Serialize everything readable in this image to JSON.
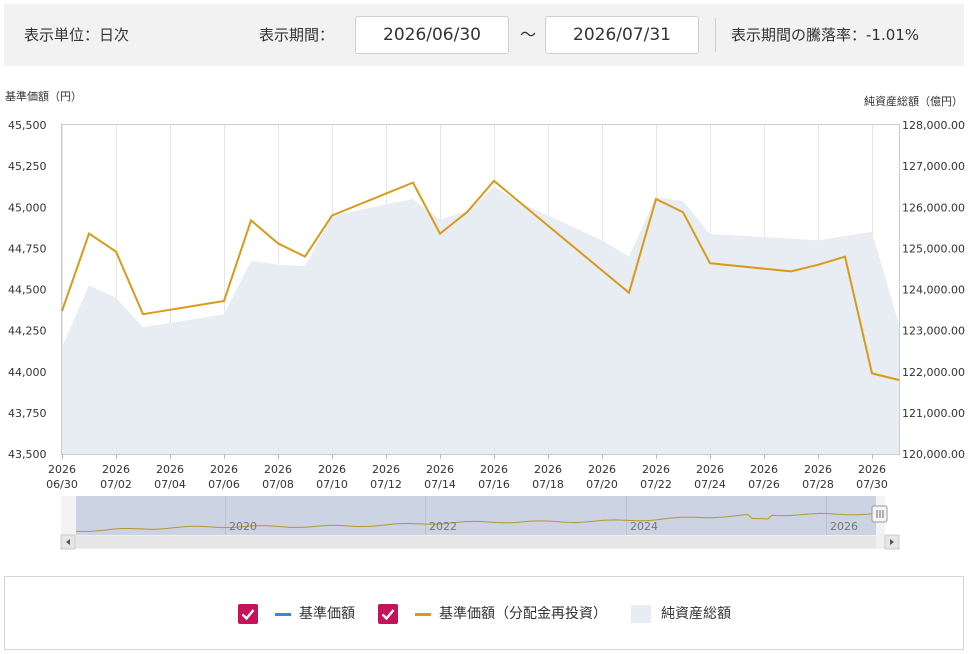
{
  "header": {
    "unit_label": "表示単位：日次",
    "period_label": "表示期間：",
    "start_date": "2026/06/30",
    "range_sep": "～",
    "end_date": "2026/07/31",
    "change_label": "表示期間の騰落率：-1.01%"
  },
  "chart_data": {
    "type": "line",
    "ylabel": "基準価額（円）",
    "y2label": "純資産総額（億円）",
    "ylim": [
      43500,
      45500
    ],
    "y2lim": [
      120000,
      128000
    ],
    "yticks": [
      "45,500",
      "45,250",
      "45,000",
      "44,750",
      "44,500",
      "44,250",
      "44,000",
      "43,750",
      "43,500"
    ],
    "y2ticks": [
      "128,000.00",
      "127,000.00",
      "126,000.00",
      "125,000.00",
      "124,000.00",
      "123,000.00",
      "122,000.00",
      "121,000.00",
      "120,000.00"
    ],
    "xticks": [
      {
        "day": 0,
        "y": "2026",
        "md": "06/30"
      },
      {
        "day": 2,
        "y": "2026",
        "md": "07/02"
      },
      {
        "day": 4,
        "y": "2026",
        "md": "07/04"
      },
      {
        "day": 6,
        "y": "2026",
        "md": "07/06"
      },
      {
        "day": 8,
        "y": "2026",
        "md": "07/08"
      },
      {
        "day": 10,
        "y": "2026",
        "md": "07/10"
      },
      {
        "day": 12,
        "y": "2026",
        "md": "07/12"
      },
      {
        "day": 14,
        "y": "2026",
        "md": "07/14"
      },
      {
        "day": 16,
        "y": "2026",
        "md": "07/16"
      },
      {
        "day": 18,
        "y": "2026",
        "md": "07/18"
      },
      {
        "day": 20,
        "y": "2026",
        "md": "07/20"
      },
      {
        "day": 22,
        "y": "2026",
        "md": "07/22"
      },
      {
        "day": 24,
        "y": "2026",
        "md": "07/24"
      },
      {
        "day": 26,
        "y": "2026",
        "md": "07/26"
      },
      {
        "day": 28,
        "y": "2026",
        "md": "07/28"
      },
      {
        "day": 30,
        "y": "2026",
        "md": "07/30"
      }
    ],
    "series": [
      {
        "name": "基準価額（分配金再投資）",
        "color": "#d99a1a",
        "points": [
          [
            0,
            44370
          ],
          [
            1,
            44840
          ],
          [
            2,
            44730
          ],
          [
            3,
            44350
          ],
          [
            6,
            44430
          ],
          [
            7,
            44920
          ],
          [
            8,
            44780
          ],
          [
            9,
            44700
          ],
          [
            10,
            44950
          ],
          [
            13,
            45150
          ],
          [
            14,
            44840
          ],
          [
            15,
            44970
          ],
          [
            16,
            45160
          ],
          [
            21,
            44480
          ],
          [
            22,
            45050
          ],
          [
            23,
            44970
          ],
          [
            24,
            44660
          ],
          [
            27,
            44610
          ],
          [
            28,
            44650
          ],
          [
            29,
            44700
          ],
          [
            30,
            43990
          ],
          [
            31,
            43950
          ]
        ]
      },
      {
        "name": "純資産総額",
        "color": "#e8edf3",
        "points": [
          [
            0,
            122600
          ],
          [
            1,
            124100
          ],
          [
            2,
            123800
          ],
          [
            3,
            123080
          ],
          [
            6,
            123400
          ],
          [
            7,
            124700
          ],
          [
            8,
            124600
          ],
          [
            9,
            124570
          ],
          [
            10,
            125800
          ],
          [
            13,
            126200
          ],
          [
            14,
            125700
          ],
          [
            15,
            125900
          ],
          [
            16,
            126500
          ],
          [
            17,
            126100
          ],
          [
            20,
            125200
          ],
          [
            21,
            124800
          ],
          [
            22,
            126250
          ],
          [
            23,
            126150
          ],
          [
            24,
            125350
          ],
          [
            28,
            125200
          ],
          [
            29,
            125300
          ],
          [
            30,
            125400
          ],
          [
            31,
            123150
          ],
          [
            32,
            123050
          ]
        ]
      },
      {
        "name": "基準価額",
        "color": "#2a8fd6",
        "points": []
      }
    ],
    "navigator": {
      "year_labels": [
        "2020",
        "2022",
        "2024",
        "2026"
      ],
      "line_color": "#b8962e"
    },
    "legend_placement": "bottom",
    "grid": "vertical"
  },
  "legend": {
    "items": [
      {
        "label": "基準価額",
        "checked": true,
        "color": "#2a8fd6"
      },
      {
        "label": "基準価額（分配金再投資）",
        "checked": true,
        "color": "#d99a1a"
      },
      {
        "label": "純資産総額",
        "color": "#e8edf3"
      }
    ]
  }
}
